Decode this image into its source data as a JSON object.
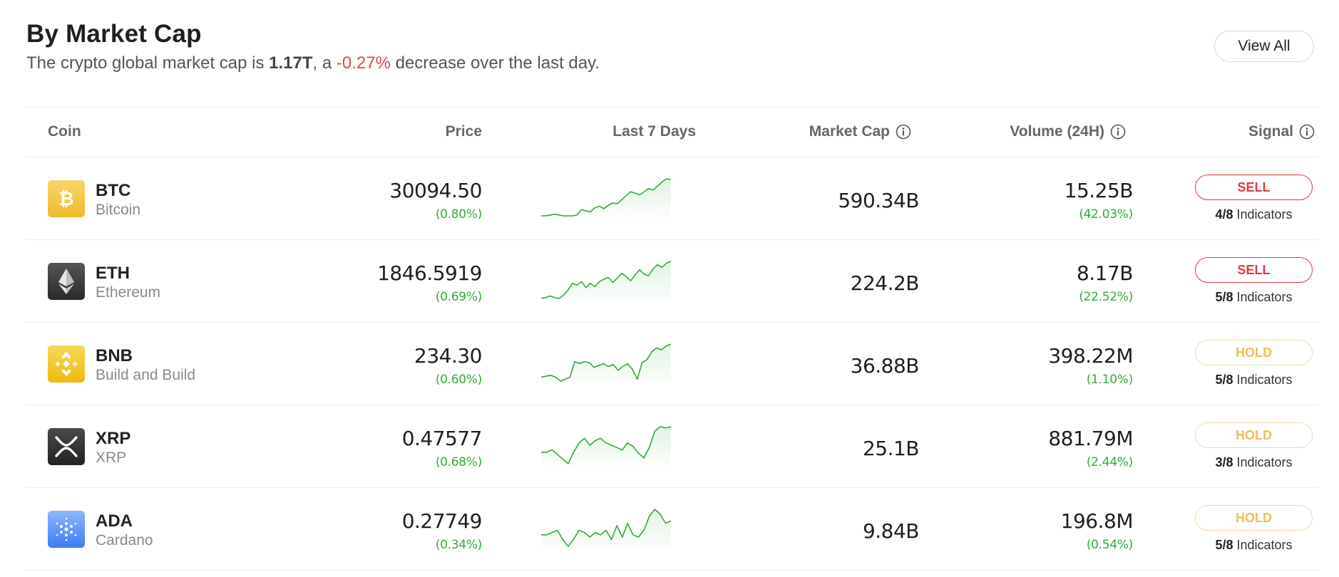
{
  "header": {
    "title": "By Market Cap",
    "subtitle_prefix": "The crypto global market cap is ",
    "market_cap": "1.17T",
    "subtitle_mid": ", a ",
    "change": "-0.27%",
    "subtitle_suffix": " decrease over the last day.",
    "view_all_label": "View All"
  },
  "columns": {
    "coin": "Coin",
    "price": "Price",
    "last7": "Last 7 Days",
    "market_cap": "Market Cap",
    "volume": "Volume (24H)",
    "signal": "Signal"
  },
  "colors": {
    "accent_green": "#35a83a",
    "sell_red": "#d93b42",
    "hold_amber": "#f1bc5c",
    "negative_red": "#e0454d"
  },
  "rows": [
    {
      "symbol": "BTC",
      "name": "Bitcoin",
      "icon": "bitcoin-icon",
      "price": "30094.50",
      "price_change": "(0.80%)",
      "market_cap": "590.34B",
      "volume": "15.25B",
      "volume_change": "(42.03%)",
      "signal": "SELL",
      "signal_type": "sell",
      "indicators_count": "4/8",
      "indicators_label": " Indicators",
      "spark": [
        20,
        20,
        21,
        22,
        21,
        20,
        20,
        20,
        21,
        28,
        26,
        25,
        30,
        32,
        29,
        33,
        36,
        35,
        40,
        45,
        50,
        48,
        46,
        50,
        54,
        52,
        57,
        62,
        66,
        65
      ]
    },
    {
      "symbol": "ETH",
      "name": "Ethereum",
      "icon": "ethereum-icon",
      "price": "1846.5919",
      "price_change": "(0.69%)",
      "market_cap": "224.2B",
      "volume": "8.17B",
      "volume_change": "(22.52%)",
      "signal": "SELL",
      "signal_type": "sell",
      "indicators_count": "5/8",
      "indicators_label": " Indicators",
      "spark": [
        20,
        21,
        23,
        21,
        20,
        24,
        30,
        38,
        36,
        40,
        33,
        38,
        34,
        40,
        43,
        45,
        39,
        44,
        50,
        46,
        41,
        48,
        54,
        49,
        47,
        55,
        60,
        57,
        62,
        64
      ]
    },
    {
      "symbol": "BNB",
      "name": "Build and Build",
      "icon": "bnb-icon",
      "price": "234.30",
      "price_change": "(0.60%)",
      "market_cap": "36.88B",
      "volume": "398.22M",
      "volume_change": "(1.10%)",
      "signal": "HOLD",
      "signal_type": "hold",
      "indicators_count": "5/8",
      "indicators_label": " Indicators",
      "spark": [
        30,
        31,
        32,
        30,
        26,
        28,
        30,
        46,
        44,
        46,
        45,
        40,
        42,
        44,
        41,
        43,
        37,
        41,
        44,
        38,
        28,
        45,
        48,
        56,
        60,
        58,
        62,
        64
      ]
    },
    {
      "symbol": "XRP",
      "name": "XRP",
      "icon": "xrp-icon",
      "price": "0.47577",
      "price_change": "(0.68%)",
      "market_cap": "25.1B",
      "volume": "881.79M",
      "volume_change": "(2.44%)",
      "signal": "HOLD",
      "signal_type": "hold",
      "indicators_count": "3/8",
      "indicators_label": " Indicators",
      "spark": [
        40,
        40,
        42,
        38,
        34,
        30,
        40,
        48,
        52,
        46,
        50,
        52,
        48,
        46,
        44,
        42,
        48,
        45,
        39,
        35,
        44,
        58,
        62,
        61,
        62
      ]
    },
    {
      "symbol": "ADA",
      "name": "Cardano",
      "icon": "cardano-icon",
      "price": "0.27749",
      "price_change": "(0.34%)",
      "market_cap": "9.84B",
      "volume": "196.8M",
      "volume_change": "(0.54%)",
      "signal": "HOLD",
      "signal_type": "hold",
      "indicators_count": "5/8",
      "indicators_label": " Indicators",
      "spark": [
        40,
        40,
        42,
        44,
        36,
        30,
        36,
        44,
        42,
        38,
        42,
        40,
        44,
        36,
        48,
        38,
        50,
        40,
        38,
        44,
        56,
        62,
        58,
        50,
        52
      ]
    }
  ]
}
